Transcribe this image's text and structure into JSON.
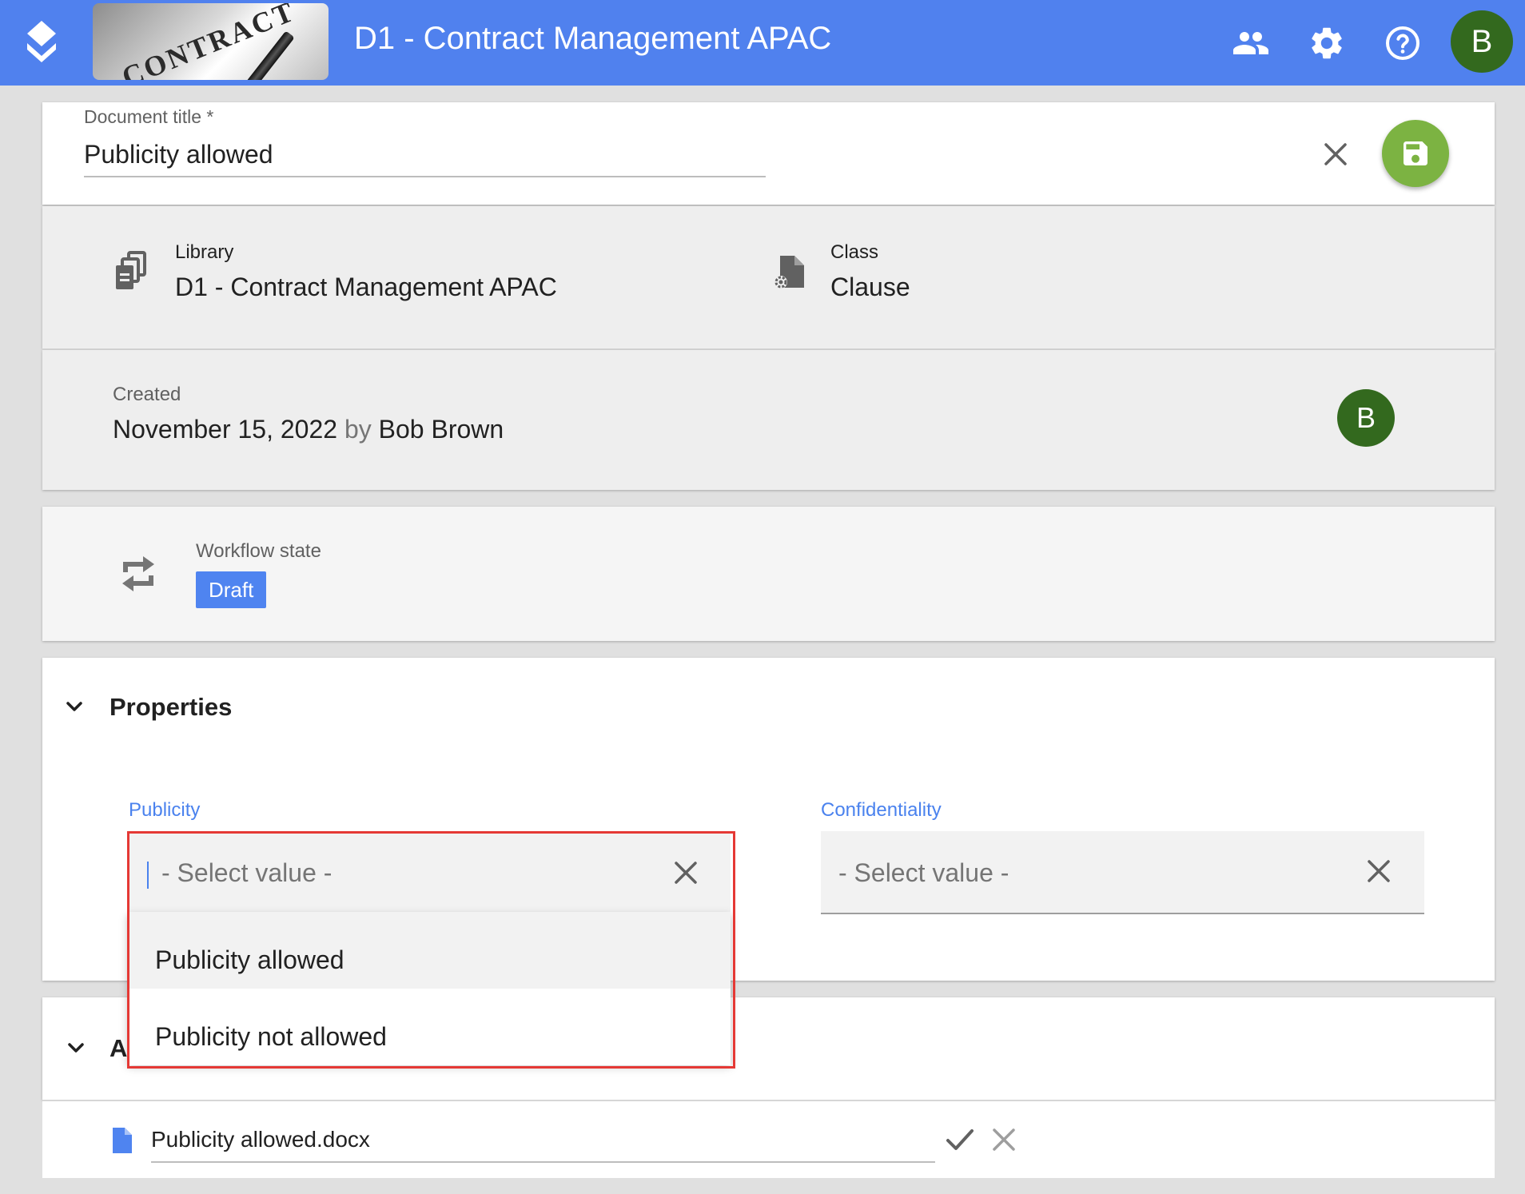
{
  "header": {
    "app_title": "D1 - Contract Management APAC",
    "banner_text": "CONTRACT",
    "avatar_initial": "B",
    "accent_color": "#5081ee",
    "icons": [
      "users-icon",
      "settings-gear-icon",
      "help-icon"
    ]
  },
  "document_title": {
    "label": "Document title *",
    "value": "Publicity allowed"
  },
  "info": {
    "library_label": "Library",
    "library_value": "D1 - Contract Management APAC",
    "class_label": "Class",
    "class_value": "Clause"
  },
  "created": {
    "label": "Created",
    "date": "November 15, 2022",
    "by": "by",
    "user": "Bob Brown",
    "avatar_initial": "B"
  },
  "workflow": {
    "label": "Workflow state",
    "state": "Draft"
  },
  "properties": {
    "title": "Properties",
    "publicity": {
      "label": "Publicity",
      "placeholder": "- Select value -",
      "options": [
        "Publicity allowed",
        "Publicity not allowed"
      ]
    },
    "confidentiality": {
      "label": "Confidentiality",
      "placeholder": "- Select value -"
    }
  },
  "attachments": {
    "title_partial": "A",
    "file_name": "Publicity allowed.docx"
  }
}
